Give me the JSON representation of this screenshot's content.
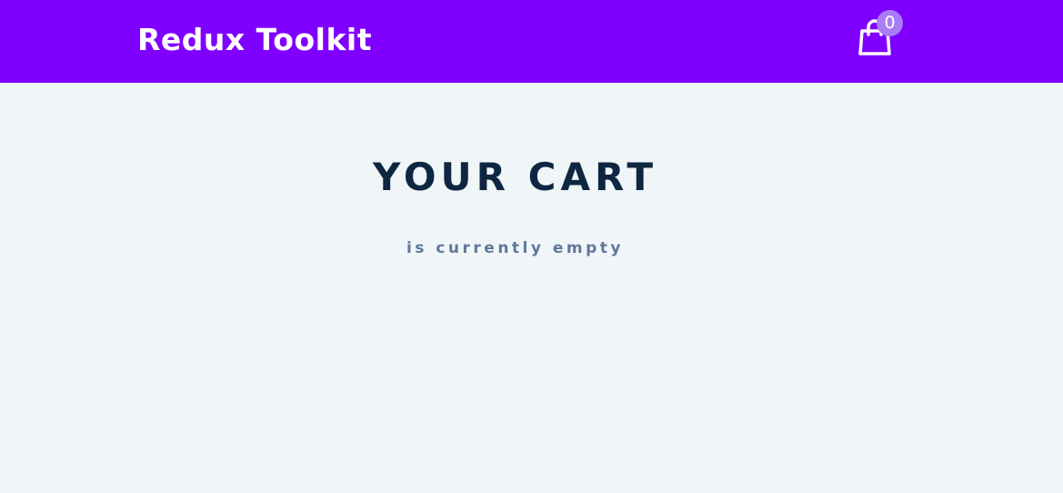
{
  "navbar": {
    "brand": "Redux Toolkit",
    "cart_count": "0",
    "background_color": "#8000ff",
    "icons": {
      "cart": "shopping-bag-icon"
    }
  },
  "cart": {
    "title": "YOUR CART",
    "empty_message": "is currently empty"
  },
  "colors": {
    "page_background": "#f0f5f8",
    "title": "#0f2641",
    "subtitle": "#60789a",
    "badge": "#a97cf6"
  }
}
